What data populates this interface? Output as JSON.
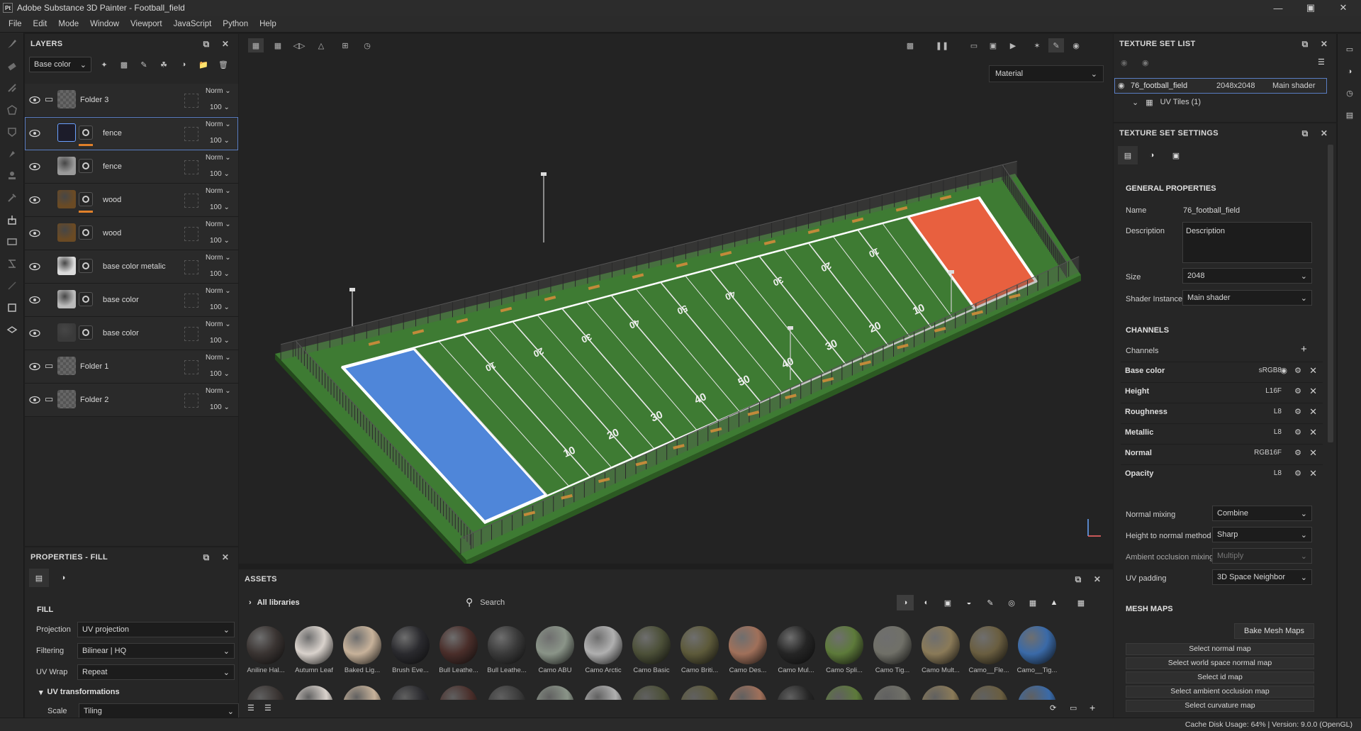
{
  "window": {
    "title": "Adobe Substance 3D Painter - Football_field",
    "logo": "Pt"
  },
  "menu": [
    "File",
    "Edit",
    "Mode",
    "Window",
    "Viewport",
    "JavaScript",
    "Python",
    "Help"
  ],
  "layers_panel": {
    "title": "LAYERS",
    "channel": "Base color",
    "layers": [
      {
        "name": "Folder 3",
        "kind": "folder",
        "blend": "Norm",
        "opacity": "100"
      },
      {
        "name": "fence",
        "kind": "fill",
        "blend": "Norm",
        "opacity": "100",
        "selected": true
      },
      {
        "name": "fence",
        "kind": "fill",
        "blend": "Norm",
        "opacity": "100"
      },
      {
        "name": "wood",
        "kind": "fill",
        "blend": "Norm",
        "opacity": "100"
      },
      {
        "name": "wood",
        "kind": "fill",
        "blend": "Norm",
        "opacity": "100"
      },
      {
        "name": "base color metalic",
        "kind": "fill",
        "blend": "Norm",
        "opacity": "100"
      },
      {
        "name": "base color",
        "kind": "fill",
        "blend": "Norm",
        "opacity": "100"
      },
      {
        "name": "base color",
        "kind": "fill",
        "blend": "Norm",
        "opacity": "100"
      },
      {
        "name": "Folder 1",
        "kind": "folder",
        "blend": "Norm",
        "opacity": "100"
      },
      {
        "name": "Folder 2",
        "kind": "folder",
        "blend": "Norm",
        "opacity": "100"
      }
    ]
  },
  "properties": {
    "title": "PROPERTIES - FILL",
    "section": "FILL",
    "projection_label": "Projection",
    "projection": "UV projection",
    "filtering_label": "Filtering",
    "filtering": "Bilinear | HQ",
    "uvwrap_label": "UV Wrap",
    "uvwrap": "Repeat",
    "uvtransform_label": "UV transformations",
    "scale_label": "Scale",
    "scale": "Tiling"
  },
  "viewport": {
    "material_mode": "Material",
    "field": {
      "yard_labels_near": [
        "10",
        "20",
        "30",
        "40",
        "50",
        "40",
        "30",
        "20",
        "10"
      ],
      "yard_labels_far": [
        "10",
        "20",
        "30",
        "40",
        "50",
        "40",
        "30",
        "20",
        "10"
      ],
      "left_endzone_color": "#4f86d9",
      "right_endzone_color": "#e8603f",
      "grass_color": "#3e7b33"
    }
  },
  "assets_panel": {
    "title": "ASSETS",
    "library": "All libraries",
    "search_placeholder": "Search",
    "items": [
      {
        "label": "Aniline Hal...",
        "color": "#3a3432"
      },
      {
        "label": "Autumn Leaf",
        "color": "#d9d2cc"
      },
      {
        "label": "Baked Lig...",
        "color": "#c7b29a"
      },
      {
        "label": "Brush Eve...",
        "color": "#2a2a2e"
      },
      {
        "label": "Bull Leathe...",
        "color": "#4a2e2a"
      },
      {
        "label": "Bull Leathe...",
        "color": "#3a3a3a"
      },
      {
        "label": "Camo  ABU",
        "color": "#8a9488"
      },
      {
        "label": "Camo  Arctic",
        "color": "#b0b0b0"
      },
      {
        "label": "Camo  Basic",
        "color": "#4c5038"
      },
      {
        "label": "Camo  Briti...",
        "color": "#5d5a3a"
      },
      {
        "label": "Camo  Des...",
        "color": "#a0705a"
      },
      {
        "label": "Camo  Mul...",
        "color": "#252525"
      },
      {
        "label": "Camo  Spli...",
        "color": "#5d7a3a"
      },
      {
        "label": "Camo  Tig...",
        "color": "#707068"
      },
      {
        "label": "Camo Mult...",
        "color": "#8a7a58"
      },
      {
        "label": "Camo__Fle...",
        "color": "#6a5e40"
      },
      {
        "label": "Camo__Tig...",
        "color": "#3a6aa8"
      }
    ]
  },
  "texture_set_list": {
    "title": "TEXTURE SET LIST",
    "name": "76_football_field",
    "size": "2048x2048",
    "shader": "Main shader",
    "uv_tiles": "UV Tiles (1)"
  },
  "texture_set_settings": {
    "title": "TEXTURE SET SETTINGS",
    "general": "GENERAL PROPERTIES",
    "name_label": "Name",
    "name": "76_football_field",
    "description_label": "Description",
    "description": "Description",
    "size_label": "Size",
    "size": "2048",
    "shader_label": "Shader Instance",
    "shader": "Main shader",
    "channels_title": "CHANNELS",
    "channels_label": "Channels",
    "channels": [
      {
        "name": "Base color",
        "format": "sRGB8"
      },
      {
        "name": "Height",
        "format": "L16F"
      },
      {
        "name": "Roughness",
        "format": "L8"
      },
      {
        "name": "Metallic",
        "format": "L8"
      },
      {
        "name": "Normal",
        "format": "RGB16F"
      },
      {
        "name": "Opacity",
        "format": "L8"
      }
    ],
    "normal_mixing_label": "Normal mixing",
    "normal_mixing": "Combine",
    "h2n_label": "Height to normal method",
    "h2n": "Sharp",
    "ao_label": "Ambient occlusion mixing",
    "ao": "Multiply",
    "uvpad_label": "UV padding",
    "uvpad": "3D Space Neighbor",
    "mesh_title": "MESH MAPS",
    "bake_button": "Bake Mesh Maps",
    "mesh_buttons": [
      "Select normal map",
      "Select world space normal map",
      "Select id map",
      "Select ambient occlusion map",
      "Select curvature map"
    ]
  },
  "status": "Cache Disk Usage:   64% | Version: 9.0.0 (OpenGL)"
}
